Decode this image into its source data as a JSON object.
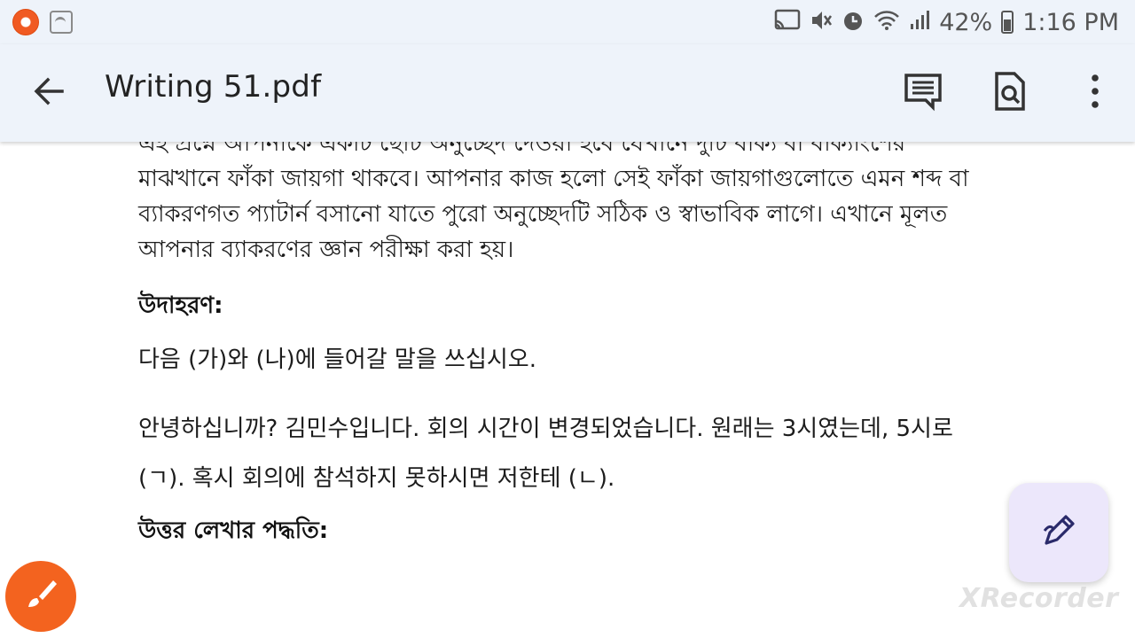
{
  "status_bar": {
    "battery_percent": "42%",
    "time": "1:16 PM"
  },
  "app_bar": {
    "title": "Writing 51.pdf"
  },
  "document": {
    "para1_lines": [
      "এই প্রশ্নে আপনাকে একটি ছোট অনুচ্ছেদ দেওয়া হবে যেখানে দুটি বাক্য বা বাক্যাংশের",
      "মাঝখানে ফাঁকা জায়গা থাকবে। আপনার কাজ হলো সেই ফাঁকা জায়গাগুলোতে এমন শব্দ বা",
      "ব্যাকরণগত প্যাটার্ন বসানো যাতে পুরো অনুচ্ছেদটি সঠিক ও স্বাভাবিক লাগে। এখানে মূলত",
      "আপনার ব্যাকরণের জ্ঞান পরীক্ষা করা হয়।"
    ],
    "example_heading": "উদাহরণ:",
    "instruction": "다음 (가)와 (나)에 들어갈 말을 쓰십시오.",
    "passage_lines": [
      "안녕하십니까? 김민수입니다. 회의 시간이 변경되었습니다. 원래는 3시였는데, 5시로",
      "(ㄱ). 혹시 회의에 참석하지 못하시면 저한테 (ㄴ)."
    ],
    "answer_heading": "উত্তর লেখার পদ্ধতি:"
  },
  "watermark": "XRecorder",
  "icons": {
    "back": "arrow-left-icon",
    "comments": "comment-icon",
    "search": "find-in-document-icon",
    "more": "more-vertical-icon",
    "edit": "edit-pen-icon",
    "brush": "brush-icon"
  },
  "colors": {
    "app_bar_bg": "#eef3fa",
    "fab_bg": "#ece7fb",
    "brush_fab_bg": "#f3631f"
  }
}
